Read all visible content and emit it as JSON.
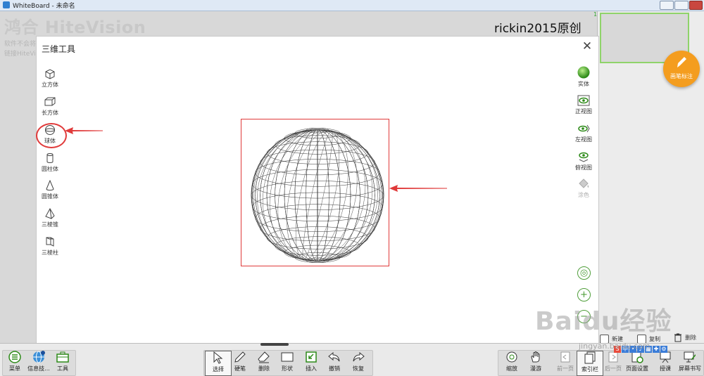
{
  "window": {
    "title": "WhiteBoard - 未命名"
  },
  "background": {
    "logo": "鸿合 HiteVision",
    "note_line1": "软件不会将",
    "note_line2": "链接HiteVi"
  },
  "credit": "rickin2015原创",
  "thumbnail": {
    "page_number": "1"
  },
  "pen_button": {
    "label": "画笔标注"
  },
  "side_actions": {
    "new_label": "新建",
    "copy_label": "复制",
    "delete_label": "删除"
  },
  "dialog": {
    "title": "三维工具",
    "close_symbol": "✕",
    "left_tools": [
      {
        "label": "立方体",
        "icon": "cube-icon"
      },
      {
        "label": "长方体",
        "icon": "cuboid-icon"
      },
      {
        "label": "球体",
        "icon": "sphere-icon",
        "selected": true
      },
      {
        "label": "圆柱体",
        "icon": "cylinder-icon"
      },
      {
        "label": "圆锥体",
        "icon": "cone-icon"
      },
      {
        "label": "三棱锥",
        "icon": "triangular-pyramid-icon"
      },
      {
        "label": "三棱柱",
        "icon": "triangular-prism-icon"
      }
    ],
    "right_tools": [
      {
        "label": "实体",
        "icon": "solid-icon"
      },
      {
        "label": "正视图",
        "icon": "front-view-icon"
      },
      {
        "label": "左视图",
        "icon": "left-view-icon"
      },
      {
        "label": "俯视图",
        "icon": "top-view-icon"
      },
      {
        "label": "涂色",
        "icon": "paint-bucket-icon",
        "disabled": true
      }
    ],
    "zoom_controls": {
      "center": "◎",
      "zoom_in": "+",
      "zoom_out": "−"
    }
  },
  "toolbar": {
    "menu": "菜单",
    "info": "信息技...",
    "tools": "工具",
    "select": "选择",
    "pen": "硬笔",
    "eraser": "删除",
    "shape": "形状",
    "insert": "插入",
    "undo": "撤销",
    "redo": "恢复",
    "zoom": "缩放",
    "roam": "漫游",
    "prev_page": "前一页",
    "index": "索引栏",
    "next_page": "后一页",
    "page_settings": "页面设置",
    "teach": "授课",
    "screen_write": "屏幕书写"
  },
  "watermark": {
    "main": "Baidu经验",
    "sub": "jingyan.baidu.com"
  },
  "colors": {
    "accent_orange": "#f49d1f",
    "highlight_red": "#e03a3a",
    "green": "#4f9e3a"
  }
}
